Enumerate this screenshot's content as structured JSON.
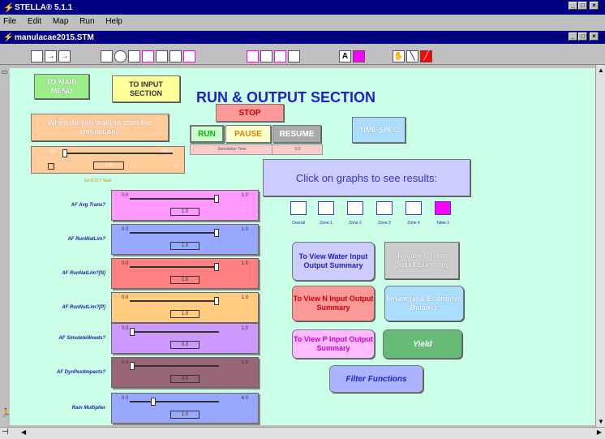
{
  "app": {
    "title": "STELLA® 5.1.1"
  },
  "menu": [
    "File",
    "Edit",
    "Map",
    "Run",
    "Help"
  ],
  "doc": {
    "title": "manulacae2015.STM"
  },
  "colors": {
    "titlebar": "#000080",
    "canvas": "#ccffe7"
  },
  "nav": {
    "main_menu": "TO MAIN MENU",
    "input_section": "TO INPUT SECTION"
  },
  "heading": "RUN & OUTPUT SECTION",
  "start_question": "When do you want to start the simulation?",
  "start_slider": {
    "min": "10",
    "max": "365.0",
    "value": "1.0",
    "caption": "Go D.O.Y Start"
  },
  "controls": {
    "stop": "STOP",
    "run": "RUN",
    "pause": "PAUSE",
    "resume": "RESUME",
    "sim_time_label": "Simulation Time",
    "sim_time_value": "0.0"
  },
  "time_spec": "TIME SPEC",
  "graphs_prompt": "Click on graphs to see results:",
  "graph_icons": [
    {
      "label": "Overall",
      "icon": "graph-icon"
    },
    {
      "label": "Zone 1",
      "icon": "graph-icon"
    },
    {
      "label": "Zone 2",
      "icon": "graph-icon"
    },
    {
      "label": "Zone 3",
      "icon": "graph-icon"
    },
    {
      "label": "Zone 4",
      "icon": "graph-icon"
    },
    {
      "label": "Table 1",
      "icon": "table-icon"
    }
  ],
  "sliders": [
    {
      "label": "AF Avg Trans?",
      "min": "0.0",
      "max": "1.0",
      "value": "1.0",
      "position": 1.0,
      "color": "#ff99ff"
    },
    {
      "label": "AF RunWatLim?",
      "min": "0.0",
      "max": "1.0",
      "value": "1.0",
      "position": 1.0,
      "color": "#99a8ff"
    },
    {
      "label": "AF RunNatLim?[N]",
      "min": "0.0",
      "max": "1.0",
      "value": "1.0",
      "position": 1.0,
      "color": "#ff8080"
    },
    {
      "label": "AF RunNutLim?[P]",
      "min": "0.0",
      "max": "1.0",
      "value": "1.0",
      "position": 1.0,
      "color": "#ffcc80"
    },
    {
      "label": "AF SimulateWeeds?",
      "min": "0.0",
      "max": "1.0",
      "value": "0.0",
      "position": 0.0,
      "color": "#cc99ff"
    },
    {
      "label": "AF DynPestImpacts?",
      "min": "0.0",
      "max": "1.0",
      "value": "0.0",
      "position": 0.0,
      "color": "#996677"
    },
    {
      "label": "Rain Multiplier",
      "min": "0.0",
      "max": "4.0",
      "value": "1.0",
      "position": 0.25,
      "color": "#99a8ff"
    }
  ],
  "summary_buttons": {
    "water": "To View Water Input Output Summary",
    "c": "To View C Input Output Summary",
    "n": "To View N Input Output Summary",
    "financial": "Financial & Economic Balance",
    "p": "To View P Input Output Summary",
    "yield": "Yield",
    "filter": "Filter Functions"
  }
}
